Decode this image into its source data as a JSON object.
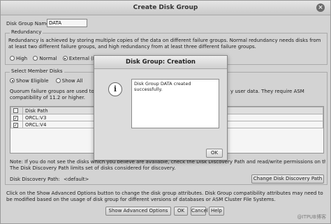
{
  "window": {
    "title": "Create Disk Group",
    "close_glyph": "×"
  },
  "disk_group_name": {
    "label": "Disk Group Name",
    "value": "DATA"
  },
  "redundancy": {
    "legend": "Redundancy",
    "description": "Redundancy is achieved by storing multiple copies of the data on different failure groups. Normal redundancy needs disks from at least two different failure groups, and high redundancy from at least three different failure groups.",
    "options": [
      {
        "label": "High",
        "selected": false
      },
      {
        "label": "Normal",
        "selected": false
      },
      {
        "label": "External (No",
        "selected": true
      }
    ]
  },
  "member_disks": {
    "legend": "Select Member Disks",
    "filter_options": [
      {
        "label": "Show Eligible",
        "selected": true
      },
      {
        "label": "Show All",
        "selected": false
      }
    ],
    "quorum_text_left": "Quorum failure groups are used to st",
    "quorum_text_left2": "compatibility of 11.2 or higher.",
    "quorum_text_right": "y user data. They require ASM",
    "table": {
      "headers": [
        "",
        "Disk Path",
        "um"
      ],
      "rows": [
        {
          "checked": true,
          "path": "ORCL:V3"
        },
        {
          "checked": true,
          "path": "ORCL:V4"
        }
      ]
    },
    "note_left": "Note: If you do not see the disks which you believe are available, check the Disk Discovery Path and read/write permissions on the disks.",
    "note_left2": "The Disk Discovery Path limits set of disks considered for discovery.",
    "discovery_label": "Disk Discovery Path:",
    "discovery_value": "<default>",
    "change_path_button": "Change Disk Discovery Path"
  },
  "footer": {
    "text": "Click on the Show Advanced Options button to change the disk group attributes. Disk Group compatibility attributes may need to be modified based on the usage of disk group for different versions of databases or ASM Cluster File Systems.",
    "buttons": {
      "advanced": "Show Advanced Options",
      "ok": "OK",
      "cancel": "Cancel",
      "help": "Help"
    }
  },
  "dialog": {
    "title": "Disk Group: Creation",
    "icon_glyph": "i",
    "message": "Disk Group DATA created successfully.",
    "ok": "OK"
  },
  "watermark": "@ITPUB博客"
}
